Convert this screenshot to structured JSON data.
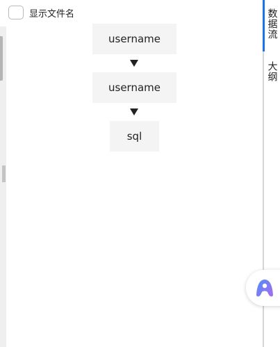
{
  "options": {
    "show_filename_label": "显示文件名"
  },
  "flow": {
    "nodes": [
      {
        "label": "username"
      },
      {
        "label": "username"
      },
      {
        "label": "sql"
      }
    ]
  },
  "side_tabs": {
    "dataflow": "数据流",
    "outline": "大纲"
  },
  "colors": {
    "active_tab": "#1a73e8",
    "node_bg": "#f4f4f4",
    "assistant_gradient_start": "#4f8df7",
    "assistant_gradient_end": "#a66cf2"
  },
  "icons": {
    "assistant": "assistant-logo-icon",
    "flow_arrow": "arrow-down-icon"
  }
}
